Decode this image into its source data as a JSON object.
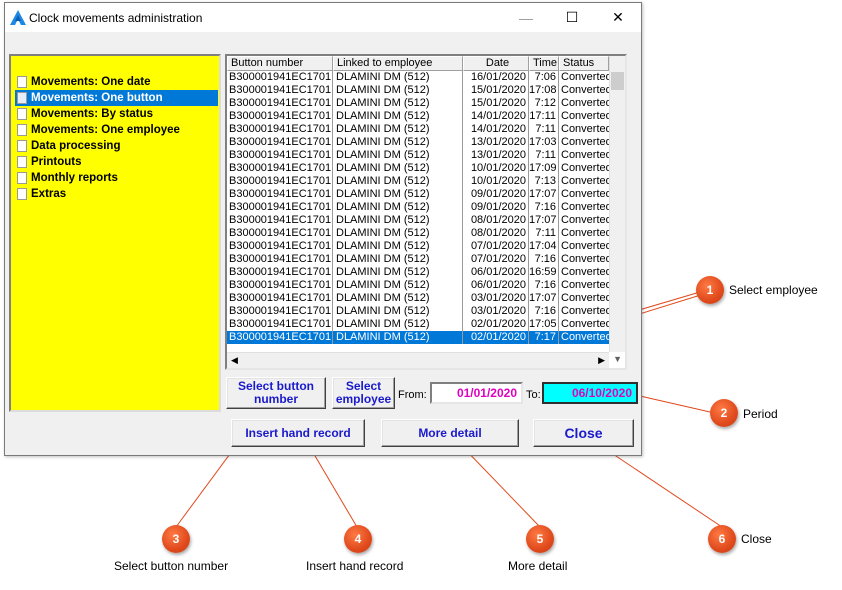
{
  "window": {
    "title": "Clock movements administration",
    "controls": {
      "minimize": "—",
      "maximize": "☐",
      "close": "✕"
    }
  },
  "menu": {
    "items": [
      {
        "label": "Movements: One date",
        "selected": false
      },
      {
        "label": "Movements: One button",
        "selected": true
      },
      {
        "label": "Movements: By status",
        "selected": false
      },
      {
        "label": "Movements: One employee",
        "selected": false
      },
      {
        "label": "Data processing",
        "selected": false
      },
      {
        "label": "Printouts",
        "selected": false
      },
      {
        "label": "Monthly reports",
        "selected": false
      },
      {
        "label": "Extras",
        "selected": false
      }
    ]
  },
  "grid": {
    "columns": [
      "Button number",
      "Linked to employee",
      "Date",
      "Time",
      "Status"
    ],
    "rows": [
      [
        "B300001941EC1701",
        "DLAMINI DM (512)",
        "16/01/2020",
        "7:06",
        "Converted"
      ],
      [
        "B300001941EC1701",
        "DLAMINI DM (512)",
        "15/01/2020",
        "17:08",
        "Converted"
      ],
      [
        "B300001941EC1701",
        "DLAMINI DM (512)",
        "15/01/2020",
        "7:12",
        "Converted"
      ],
      [
        "B300001941EC1701",
        "DLAMINI DM (512)",
        "14/01/2020",
        "17:11",
        "Converted"
      ],
      [
        "B300001941EC1701",
        "DLAMINI DM (512)",
        "14/01/2020",
        "7:11",
        "Converted"
      ],
      [
        "B300001941EC1701",
        "DLAMINI DM (512)",
        "13/01/2020",
        "17:03",
        "Converted"
      ],
      [
        "B300001941EC1701",
        "DLAMINI DM (512)",
        "13/01/2020",
        "7:11",
        "Converted"
      ],
      [
        "B300001941EC1701",
        "DLAMINI DM (512)",
        "10/01/2020",
        "17:09",
        "Converted"
      ],
      [
        "B300001941EC1701",
        "DLAMINI DM (512)",
        "10/01/2020",
        "7:13",
        "Converted"
      ],
      [
        "B300001941EC1701",
        "DLAMINI DM (512)",
        "09/01/2020",
        "17:07",
        "Converted"
      ],
      [
        "B300001941EC1701",
        "DLAMINI DM (512)",
        "09/01/2020",
        "7:16",
        "Converted"
      ],
      [
        "B300001941EC1701",
        "DLAMINI DM (512)",
        "08/01/2020",
        "17:07",
        "Converted"
      ],
      [
        "B300001941EC1701",
        "DLAMINI DM (512)",
        "08/01/2020",
        "7:11",
        "Converted"
      ],
      [
        "B300001941EC1701",
        "DLAMINI DM (512)",
        "07/01/2020",
        "17:04",
        "Converted"
      ],
      [
        "B300001941EC1701",
        "DLAMINI DM (512)",
        "07/01/2020",
        "7:16",
        "Converted"
      ],
      [
        "B300001941EC1701",
        "DLAMINI DM (512)",
        "06/01/2020",
        "16:59",
        "Converted"
      ],
      [
        "B300001941EC1701",
        "DLAMINI DM (512)",
        "06/01/2020",
        "7:16",
        "Converted"
      ],
      [
        "B300001941EC1701",
        "DLAMINI DM (512)",
        "03/01/2020",
        "17:07",
        "Converted"
      ],
      [
        "B300001941EC1701",
        "DLAMINI DM (512)",
        "03/01/2020",
        "7:16",
        "Converted"
      ],
      [
        "B300001941EC1701",
        "DLAMINI DM (512)",
        "02/01/2020",
        "17:05",
        "Converted"
      ],
      [
        "B300001941EC1701",
        "DLAMINI DM (512)",
        "02/01/2020",
        "7:17",
        "Converted"
      ]
    ],
    "selected_row": 20
  },
  "buttons": {
    "select_button_number": "Select button number",
    "select_employee": "Select employee",
    "insert_hand_record": "Insert hand record",
    "more_detail": "More detail",
    "close": "Close"
  },
  "period": {
    "from_label": "From:",
    "from_value": "01/01/2020",
    "to_label": "To:",
    "to_value": "06/10/2020"
  },
  "callouts": [
    {
      "num": "1",
      "label": "Select employee"
    },
    {
      "num": "2",
      "label": "Period"
    },
    {
      "num": "3",
      "label": "Select button number"
    },
    {
      "num": "4",
      "label": "Insert hand record"
    },
    {
      "num": "5",
      "label": "More detail"
    },
    {
      "num": "6",
      "label": "Close"
    }
  ],
  "colors": {
    "menu_background": "#ffff00",
    "selection": "#0078d7",
    "button_text": "#1a1acc",
    "date_text": "#e000c0",
    "to_date_background": "#00ffff",
    "callout": "#e04a1c"
  }
}
